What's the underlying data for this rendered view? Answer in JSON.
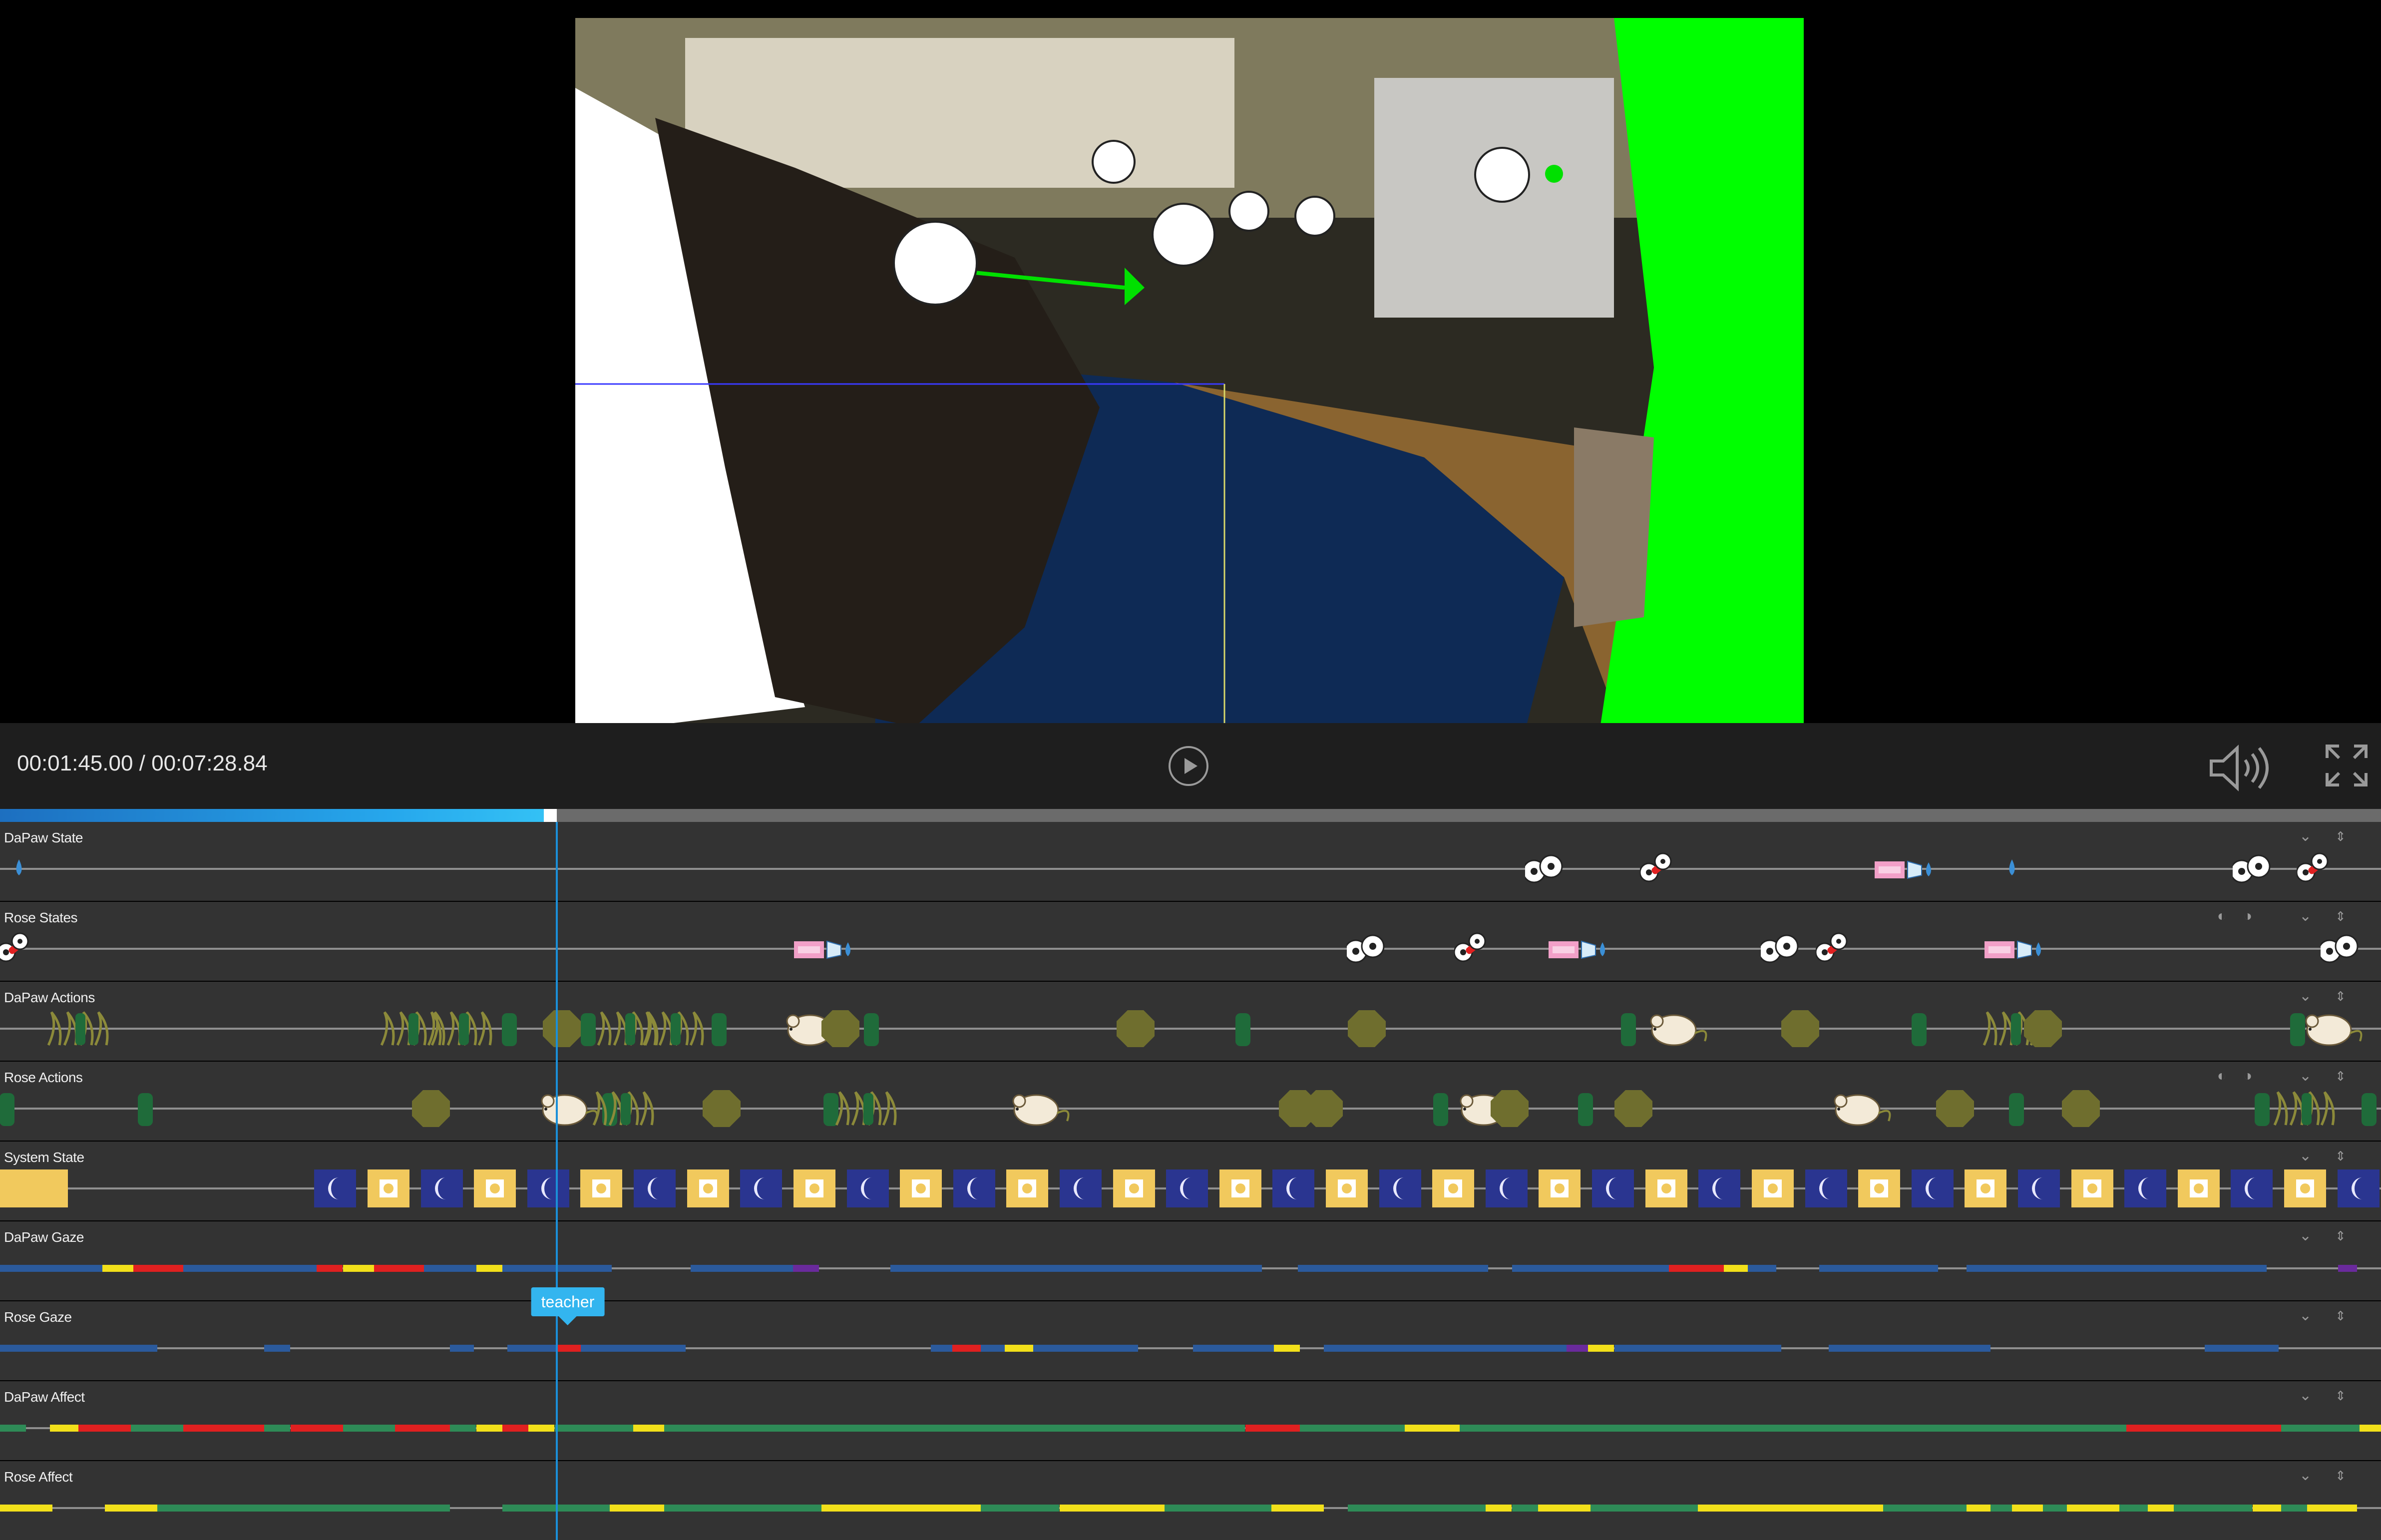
{
  "player": {
    "current_time": "00:01:45.00",
    "total_time": "00:07:28.84",
    "time_display": "00:01:45.00 / 00:07:28.84",
    "progress_fraction": 0.2338,
    "progress_color": "#26a7ec"
  },
  "icons": {
    "play": "play-icon",
    "volume": "volume-icon",
    "fullscreen": "fullscreen-icon",
    "collapse": "chevron-down-icon",
    "reorder": "reorder-icon",
    "zoom": "zoom-icon"
  },
  "tooltip": {
    "label": "teacher",
    "color": "#33b5ef"
  },
  "colors": {
    "track_bg": "#333333",
    "gaze_blue": "#2b5a9c",
    "gaze_red": "#e02020",
    "gaze_yellow": "#f2e01a",
    "gaze_purple": "#6a2a9c",
    "affect_green": "#2e8b57",
    "affect_red": "#e02020",
    "affect_yellow": "#f2e01a",
    "night_blue": "#2a3590",
    "day_yellow": "#f1c95d",
    "action_green": "#1f6b3a",
    "action_olive": "#6f6e2e",
    "playhead": "#1b8fd8"
  },
  "tracks": [
    {
      "label": "DaPaw State",
      "kind": "state"
    },
    {
      "label": "Rose States",
      "kind": "state"
    },
    {
      "label": "DaPaw Actions",
      "kind": "action"
    },
    {
      "label": "Rose Actions",
      "kind": "action"
    },
    {
      "label": "System State",
      "kind": "system"
    },
    {
      "label": "DaPaw Gaze",
      "kind": "gaze"
    },
    {
      "label": "Rose Gaze",
      "kind": "gaze"
    },
    {
      "label": "DaPaw Affect",
      "kind": "affect"
    },
    {
      "label": "Rose Affect",
      "kind": "affect"
    }
  ],
  "events": {
    "dapaw_state": [
      {
        "t": 0.008,
        "icon": "drop"
      },
      {
        "t": 0.649,
        "icon": "eyes"
      },
      {
        "t": 0.696,
        "icon": "pill"
      },
      {
        "t": 0.8,
        "icon": "label-drop"
      },
      {
        "t": 0.845,
        "icon": "drop"
      },
      {
        "t": 0.946,
        "icon": "eyes"
      },
      {
        "t": 0.972,
        "icon": "pill"
      }
    ],
    "rose_state": [
      {
        "t": 0.006,
        "icon": "pill"
      },
      {
        "t": 0.346,
        "icon": "label-drop"
      },
      {
        "t": 0.574,
        "icon": "eyes"
      },
      {
        "t": 0.618,
        "icon": "pill"
      },
      {
        "t": 0.663,
        "icon": "label-drop"
      },
      {
        "t": 0.748,
        "icon": "eyes"
      },
      {
        "t": 0.77,
        "icon": "pill"
      },
      {
        "t": 0.846,
        "icon": "label-drop"
      },
      {
        "t": 0.983,
        "icon": "eyes"
      }
    ],
    "dapaw_actions": [
      {
        "t": 0.035,
        "icon": "walk"
      },
      {
        "t": 0.175,
        "icon": "walk"
      },
      {
        "t": 0.196,
        "icon": "walk"
      },
      {
        "t": 0.214,
        "icon": "bar"
      },
      {
        "t": 0.236,
        "icon": "oct"
      },
      {
        "t": 0.247,
        "icon": "bar"
      },
      {
        "t": 0.266,
        "icon": "walk"
      },
      {
        "t": 0.285,
        "icon": "walk"
      },
      {
        "t": 0.302,
        "icon": "bar"
      },
      {
        "t": 0.342,
        "icon": "mouse"
      },
      {
        "t": 0.353,
        "icon": "oct"
      },
      {
        "t": 0.366,
        "icon": "bar"
      },
      {
        "t": 0.477,
        "icon": "oct"
      },
      {
        "t": 0.522,
        "icon": "bar"
      },
      {
        "t": 0.574,
        "icon": "oct"
      },
      {
        "t": 0.684,
        "icon": "bar"
      },
      {
        "t": 0.705,
        "icon": "mouse"
      },
      {
        "t": 0.756,
        "icon": "oct"
      },
      {
        "t": 0.806,
        "icon": "bar"
      },
      {
        "t": 0.848,
        "icon": "walk"
      },
      {
        "t": 0.858,
        "icon": "oct"
      },
      {
        "t": 0.965,
        "icon": "bar"
      },
      {
        "t": 0.98,
        "icon": "mouse"
      }
    ],
    "rose_actions": [
      {
        "t": 0.003,
        "icon": "bar"
      },
      {
        "t": 0.061,
        "icon": "bar"
      },
      {
        "t": 0.181,
        "icon": "oct"
      },
      {
        "t": 0.239,
        "icon": "mouse"
      },
      {
        "t": 0.256,
        "icon": "bar"
      },
      {
        "t": 0.264,
        "icon": "walk"
      },
      {
        "t": 0.303,
        "icon": "oct"
      },
      {
        "t": 0.349,
        "icon": "bar"
      },
      {
        "t": 0.366,
        "icon": "walk"
      },
      {
        "t": 0.437,
        "icon": "mouse"
      },
      {
        "t": 0.545,
        "icon": "oct"
      },
      {
        "t": 0.556,
        "icon": "oct"
      },
      {
        "t": 0.605,
        "icon": "bar"
      },
      {
        "t": 0.625,
        "icon": "mouse"
      },
      {
        "t": 0.634,
        "icon": "oct"
      },
      {
        "t": 0.666,
        "icon": "bar"
      },
      {
        "t": 0.686,
        "icon": "oct"
      },
      {
        "t": 0.782,
        "icon": "mouse"
      },
      {
        "t": 0.821,
        "icon": "oct"
      },
      {
        "t": 0.847,
        "icon": "bar"
      },
      {
        "t": 0.874,
        "icon": "oct"
      },
      {
        "t": 0.95,
        "icon": "bar"
      },
      {
        "t": 0.97,
        "icon": "walk"
      },
      {
        "t": 0.995,
        "icon": "bar"
      }
    ]
  },
  "system_state": {
    "first": {
      "t0": 0.0,
      "t1": 0.016,
      "kind": "day"
    },
    "alternating_start": 0.132,
    "alternating_step": 0.02236,
    "count": 40
  },
  "gaze": {
    "dapaw": [
      [
        0.0,
        0.043,
        "blue"
      ],
      [
        0.043,
        0.056,
        "yellow"
      ],
      [
        0.056,
        0.077,
        "red"
      ],
      [
        0.077,
        0.133,
        "blue"
      ],
      [
        0.133,
        0.144,
        "red"
      ],
      [
        0.144,
        0.157,
        "yellow"
      ],
      [
        0.157,
        0.178,
        "red"
      ],
      [
        0.178,
        0.2,
        "blue"
      ],
      [
        0.2,
        0.211,
        "yellow"
      ],
      [
        0.211,
        0.257,
        "blue"
      ],
      [
        0.29,
        0.333,
        "blue"
      ],
      [
        0.333,
        0.344,
        "purple"
      ],
      [
        0.374,
        0.53,
        "blue"
      ],
      [
        0.545,
        0.625,
        "blue"
      ],
      [
        0.635,
        0.701,
        "blue"
      ],
      [
        0.701,
        0.724,
        "red"
      ],
      [
        0.724,
        0.734,
        "yellow"
      ],
      [
        0.734,
        0.746,
        "blue"
      ],
      [
        0.764,
        0.814,
        "blue"
      ],
      [
        0.826,
        0.952,
        "blue"
      ],
      [
        0.982,
        0.99,
        "purple"
      ]
    ],
    "rose": [
      [
        0.0,
        0.066,
        "blue"
      ],
      [
        0.111,
        0.122,
        "blue"
      ],
      [
        0.189,
        0.199,
        "blue"
      ],
      [
        0.213,
        0.234,
        "blue"
      ],
      [
        0.234,
        0.244,
        "red"
      ],
      [
        0.244,
        0.288,
        "blue"
      ],
      [
        0.391,
        0.4,
        "blue"
      ],
      [
        0.4,
        0.412,
        "red"
      ],
      [
        0.412,
        0.422,
        "blue"
      ],
      [
        0.422,
        0.434,
        "yellow"
      ],
      [
        0.434,
        0.478,
        "blue"
      ],
      [
        0.501,
        0.535,
        "blue"
      ],
      [
        0.535,
        0.546,
        "yellow"
      ],
      [
        0.556,
        0.658,
        "blue"
      ],
      [
        0.658,
        0.667,
        "purple"
      ],
      [
        0.667,
        0.678,
        "yellow"
      ],
      [
        0.678,
        0.748,
        "blue"
      ],
      [
        0.768,
        0.836,
        "blue"
      ],
      [
        0.926,
        0.957,
        "blue"
      ]
    ]
  },
  "affect": {
    "dapaw": [
      [
        0.0,
        0.011,
        "green"
      ],
      [
        0.021,
        0.033,
        "yellow"
      ],
      [
        0.033,
        0.055,
        "red"
      ],
      [
        0.055,
        0.077,
        "green"
      ],
      [
        0.077,
        0.111,
        "red"
      ],
      [
        0.111,
        0.122,
        "green"
      ],
      [
        0.122,
        0.144,
        "red"
      ],
      [
        0.144,
        0.166,
        "green"
      ],
      [
        0.166,
        0.189,
        "red"
      ],
      [
        0.189,
        0.2,
        "green"
      ],
      [
        0.2,
        0.211,
        "yellow"
      ],
      [
        0.211,
        0.222,
        "red"
      ],
      [
        0.222,
        0.233,
        "yellow"
      ],
      [
        0.233,
        0.266,
        "green"
      ],
      [
        0.266,
        0.279,
        "yellow"
      ],
      [
        0.279,
        0.523,
        "green"
      ],
      [
        0.523,
        0.546,
        "red"
      ],
      [
        0.546,
        0.59,
        "green"
      ],
      [
        0.59,
        0.613,
        "yellow"
      ],
      [
        0.613,
        0.893,
        "green"
      ],
      [
        0.893,
        0.958,
        "red"
      ],
      [
        0.958,
        0.991,
        "green"
      ],
      [
        0.991,
        1.0,
        "yellow"
      ]
    ],
    "rose": [
      [
        0.0,
        0.022,
        "yellow"
      ],
      [
        0.044,
        0.066,
        "yellow"
      ],
      [
        0.066,
        0.189,
        "green"
      ],
      [
        0.211,
        0.256,
        "green"
      ],
      [
        0.256,
        0.279,
        "yellow"
      ],
      [
        0.279,
        0.345,
        "green"
      ],
      [
        0.345,
        0.412,
        "yellow"
      ],
      [
        0.412,
        0.445,
        "green"
      ],
      [
        0.445,
        0.489,
        "yellow"
      ],
      [
        0.489,
        0.534,
        "green"
      ],
      [
        0.534,
        0.556,
        "yellow"
      ],
      [
        0.566,
        0.624,
        "green"
      ],
      [
        0.624,
        0.635,
        "yellow"
      ],
      [
        0.635,
        0.646,
        "green"
      ],
      [
        0.646,
        0.668,
        "yellow"
      ],
      [
        0.668,
        0.713,
        "green"
      ],
      [
        0.713,
        0.791,
        "yellow"
      ],
      [
        0.791,
        0.826,
        "green"
      ],
      [
        0.826,
        0.836,
        "yellow"
      ],
      [
        0.836,
        0.845,
        "green"
      ],
      [
        0.845,
        0.858,
        "yellow"
      ],
      [
        0.858,
        0.868,
        "green"
      ],
      [
        0.868,
        0.89,
        "yellow"
      ],
      [
        0.89,
        0.902,
        "green"
      ],
      [
        0.902,
        0.913,
        "yellow"
      ],
      [
        0.913,
        0.946,
        "green"
      ],
      [
        0.946,
        0.958,
        "yellow"
      ],
      [
        0.958,
        0.969,
        "green"
      ],
      [
        0.969,
        0.99,
        "yellow"
      ]
    ]
  }
}
